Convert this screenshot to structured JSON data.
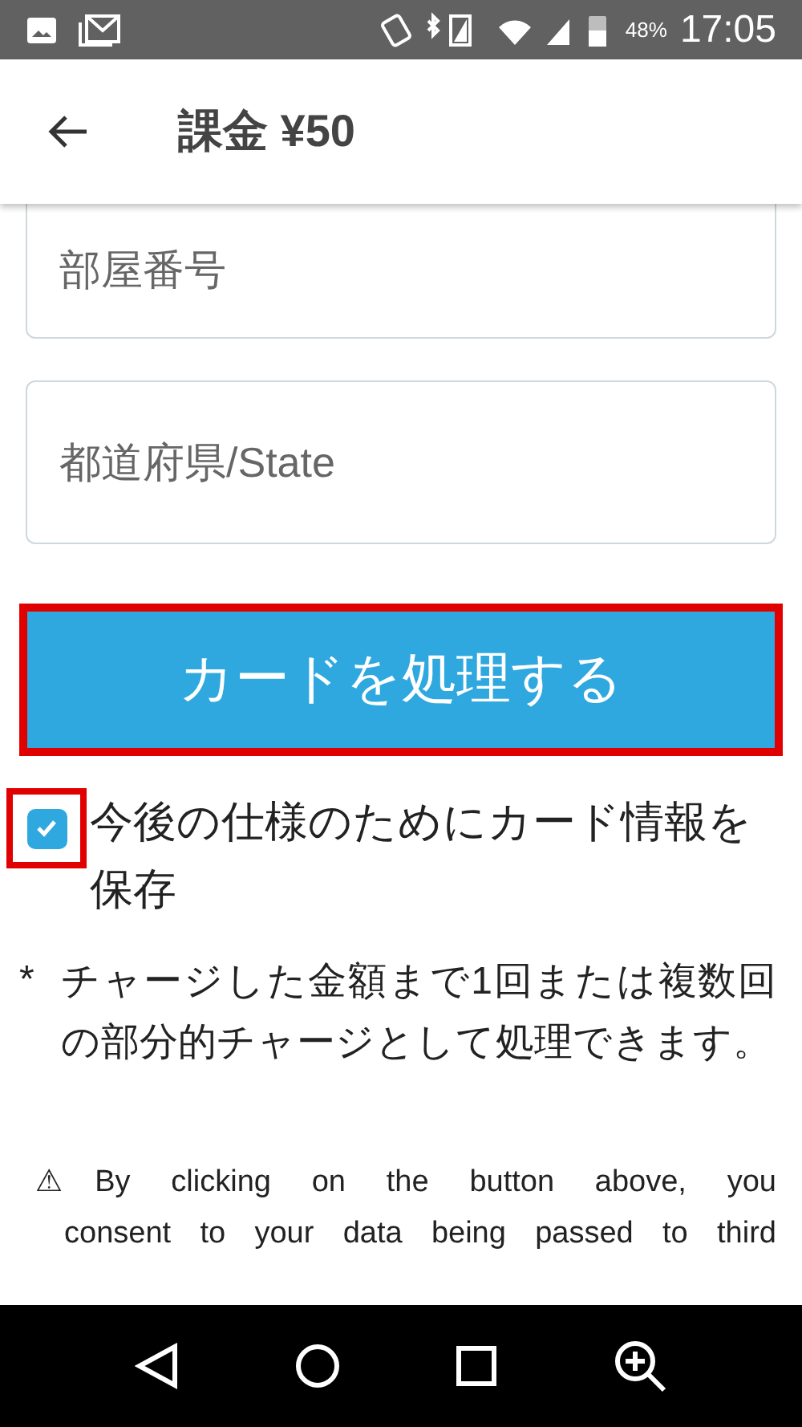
{
  "status_bar": {
    "battery": "48%",
    "time": "17:05"
  },
  "app_bar": {
    "title": "課金 ¥50"
  },
  "fields": [
    {
      "placeholder": "部屋番号",
      "cut": true
    },
    {
      "placeholder": "都道府県/State",
      "cut": false
    }
  ],
  "submit_button": {
    "label": "カードを処理する",
    "highlighted": true
  },
  "save_card": {
    "label": "今後の仕様のためにカード情報を保存",
    "checked": true,
    "highlighted": true
  },
  "note": {
    "mark": "*",
    "text": "チャージした金額まで1回または複数回の部分的チャージとして処理できます。"
  },
  "consent": {
    "lines": [
      "⚠By clicking on the button above, you",
      "consent to your data being passed to third"
    ]
  }
}
